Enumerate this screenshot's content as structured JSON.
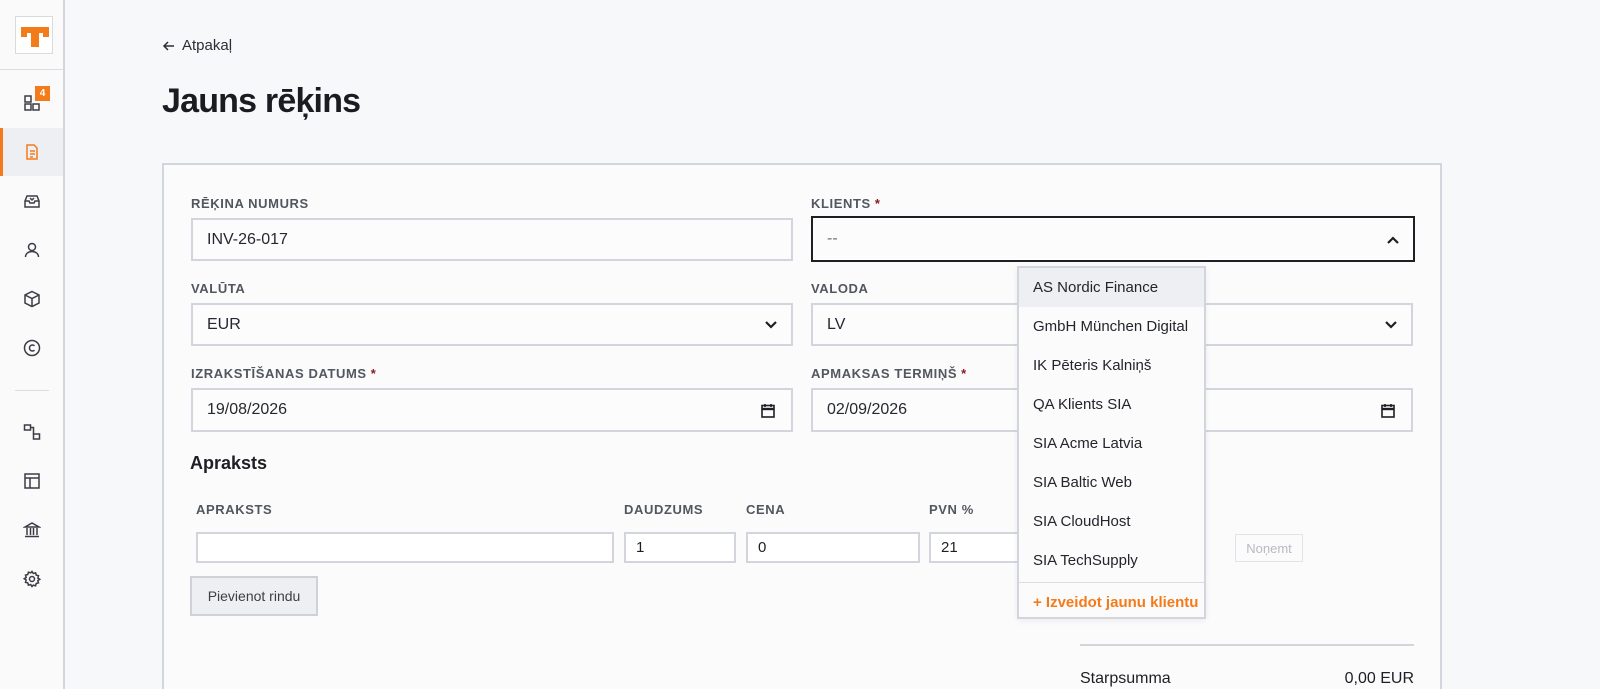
{
  "colors": {
    "accent": "#f47b1a",
    "text": "#1d1f24",
    "border": "#d3d5de",
    "required": "#8a1a1a"
  },
  "sidebar": {
    "logo": "app-logo",
    "badge_count": "4",
    "items": [
      {
        "name": "dashboard",
        "icon": "dashboard-icon"
      },
      {
        "name": "invoices",
        "icon": "document-icon",
        "active": true
      },
      {
        "name": "inbox",
        "icon": "inbox-icon"
      },
      {
        "name": "clients",
        "icon": "user-icon"
      },
      {
        "name": "products",
        "icon": "box-icon"
      },
      {
        "name": "copyright",
        "icon": "copyright-icon"
      },
      {
        "name": "integrations",
        "icon": "flow-icon"
      },
      {
        "name": "layout",
        "icon": "layout-icon"
      },
      {
        "name": "bank",
        "icon": "bank-icon"
      },
      {
        "name": "settings",
        "icon": "gear-icon"
      }
    ]
  },
  "header": {
    "back_label": "Atpakaļ",
    "title": "Jauns rēķins"
  },
  "form": {
    "invoice_number": {
      "label": "RĒĶINA NUMURS",
      "value": "INV-26-017"
    },
    "client": {
      "label": "KLIENTS",
      "required_mark": "*",
      "value": "--"
    },
    "currency": {
      "label": "VALŪTA",
      "value": "EUR"
    },
    "language": {
      "label": "VALODA",
      "value": "LV"
    },
    "issue_date": {
      "label": "IZRAKSTĪŠANAS DATUMS",
      "required_mark": "*",
      "value": "19/08/2026"
    },
    "due_date": {
      "label": "APMAKSAS TERMIŅŠ",
      "required_mark": "*",
      "value": "02/09/2026"
    }
  },
  "lines": {
    "section_title": "Apraksts",
    "columns": [
      "APRAKSTS",
      "DAUDZUMS",
      "CENA",
      "PVN %"
    ],
    "row": {
      "description": "",
      "quantity": "1",
      "price": "0",
      "vat": "21"
    },
    "remove_label": "Noņemt",
    "add_row_label": "Pievienot rindu"
  },
  "summary": {
    "subtotal_label": "Starpsumma",
    "subtotal_value": "0,00 EUR"
  },
  "client_dropdown": {
    "options": [
      "AS Nordic Finance",
      "GmbH München Digital",
      "IK Pēteris Kalniņš",
      "QA Klients SIA",
      "SIA Acme Latvia",
      "SIA Baltic Web",
      "SIA CloudHost",
      "SIA TechSupply"
    ],
    "highlighted_index": 0,
    "create_label": "+ Izveidot jaunu klientu"
  }
}
